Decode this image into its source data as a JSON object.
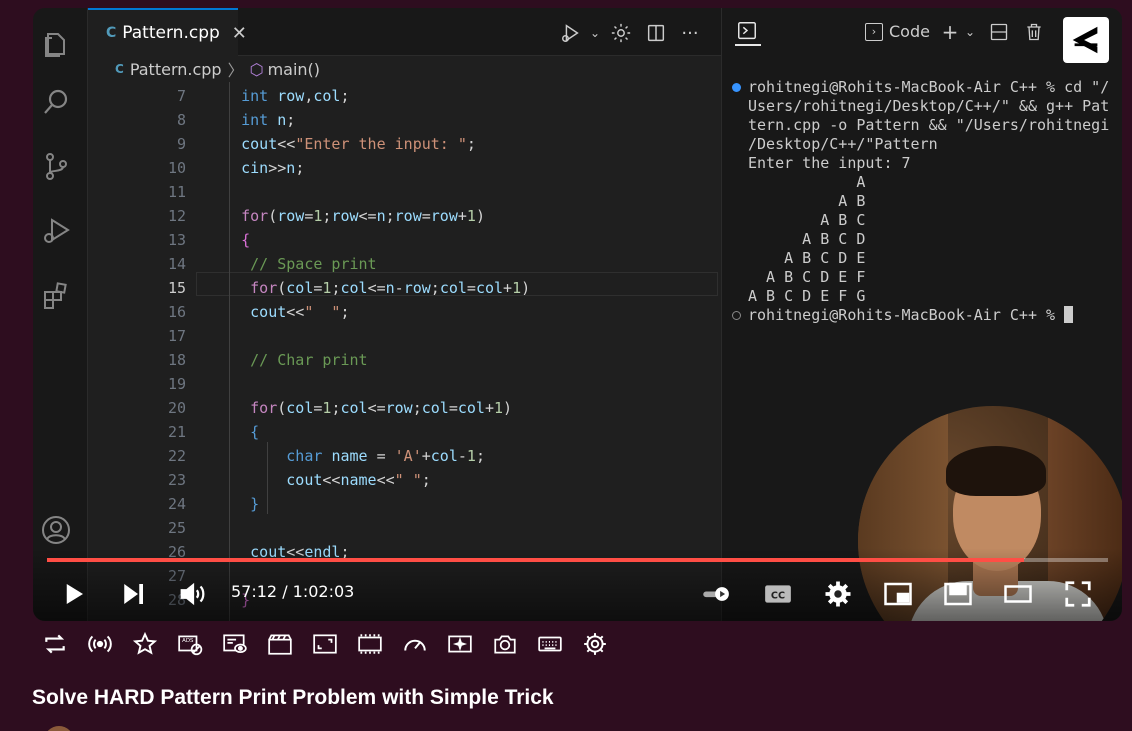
{
  "editor": {
    "tab_label": "Pattern.cpp",
    "tab_close": "✕",
    "file_icon": "C",
    "breadcrumb": {
      "file": "Pattern.cpp",
      "separator": "〉",
      "symbol": "main()"
    },
    "toolbar_icons": [
      "run-icon",
      "gear-icon",
      "split-editor-icon",
      "more-icon"
    ],
    "code_lines": [
      {
        "num": "7",
        "html": "    <span class=\"k\">int</span> <span class=\"v\">row</span>,<span class=\"v\">col</span>;"
      },
      {
        "num": "8",
        "html": "    <span class=\"k\">int</span> <span class=\"v\">n</span>;"
      },
      {
        "num": "9",
        "html": "    <span class=\"v\">cout</span>&lt;&lt;<span class=\"s\">\"Enter the input: \"</span>;"
      },
      {
        "num": "10",
        "html": "    <span class=\"v\">cin</span>&gt;&gt;<span class=\"v\">n</span>;"
      },
      {
        "num": "11",
        "html": ""
      },
      {
        "num": "12",
        "html": "    <span class=\"c\">for</span>(<span class=\"v\">row</span>=<span class=\"n\">1</span>;<span class=\"v\">row</span>&lt;=<span class=\"v\">n</span>;<span class=\"v\">row</span>=<span class=\"v\">row</span>+<span class=\"n\">1</span>)"
      },
      {
        "num": "13",
        "html": "    <span class=\"b\">{</span>"
      },
      {
        "num": "14",
        "html": "     <span class=\"cm\">// Space print</span>"
      },
      {
        "num": "15",
        "html": "     <span class=\"c\">for</span>(<span class=\"v\">col</span>=<span class=\"n\">1</span>;<span class=\"v\">col</span>&lt;=<span class=\"v\">n</span>-<span class=\"v\">row</span>;<span class=\"v\">col</span>=<span class=\"v\">col</span>+<span class=\"n\">1</span>)"
      },
      {
        "num": "16",
        "html": "     <span class=\"v\">cout</span>&lt;&lt;<span class=\"s\">\"  \"</span>;"
      },
      {
        "num": "17",
        "html": ""
      },
      {
        "num": "18",
        "html": "     <span class=\"cm\">// Char print</span>"
      },
      {
        "num": "19",
        "html": ""
      },
      {
        "num": "20",
        "html": "     <span class=\"c\">for</span>(<span class=\"v\">col</span>=<span class=\"n\">1</span>;<span class=\"v\">col</span>&lt;=<span class=\"v\">row</span>;<span class=\"v\">col</span>=<span class=\"v\">col</span>+<span class=\"n\">1</span>)"
      },
      {
        "num": "21",
        "html": "     <span class=\"k\">{</span>"
      },
      {
        "num": "22",
        "html": "         <span class=\"k\">char</span> <span class=\"v\">name</span> = <span class=\"s\">'A'</span>+<span class=\"v\">col</span>-<span class=\"n\">1</span>;"
      },
      {
        "num": "23",
        "html": "         <span class=\"v\">cout</span>&lt;&lt;<span class=\"v\">name</span>&lt;&lt;<span class=\"s\">\" \"</span>;"
      },
      {
        "num": "24",
        "html": "     <span class=\"k\">}</span>"
      },
      {
        "num": "25",
        "html": ""
      },
      {
        "num": "26",
        "html": "     <span class=\"v\">cout</span>&lt;&lt;<span class=\"v\">endl</span>;"
      },
      {
        "num": "27",
        "html": ""
      },
      {
        "num": "28",
        "html": "    <span class=\"b\">}</span>"
      }
    ],
    "current_line": "15"
  },
  "terminal": {
    "code_label": "Code",
    "lines": [
      "rohitnegi@Rohits-MacBook-Air C++ % cd \"/",
      "Users/rohitnegi/Desktop/C++/\" && g++ Pat",
      "tern.cpp -o Pattern && \"/Users/rohitnegi",
      "/Desktop/C++/\"Pattern",
      "Enter the input: 7",
      "            A",
      "          A B",
      "        A B C",
      "      A B C D",
      "    A B C D E",
      "  A B C D E F",
      "A B C D E F G"
    ],
    "prompt": "rohitnegi@Rohits-MacBook-Air C++ % "
  },
  "player": {
    "time_display": "57:12 / 1:02:03",
    "progress": 0.921,
    "accent": "#ff4e45"
  },
  "extension_icons": [
    "loop-icon",
    "broadcast-icon",
    "star-icon",
    "ads-blocked-icon",
    "picture-in-picture-icon",
    "clapper-icon",
    "aspect-ratio-icon",
    "film-strip-icon",
    "speedometer-icon",
    "sparkle-icon",
    "camera-icon",
    "keyboard-icon",
    "gear-icon"
  ],
  "video_title": "Solve HARD Pattern Print Problem with Simple Trick"
}
